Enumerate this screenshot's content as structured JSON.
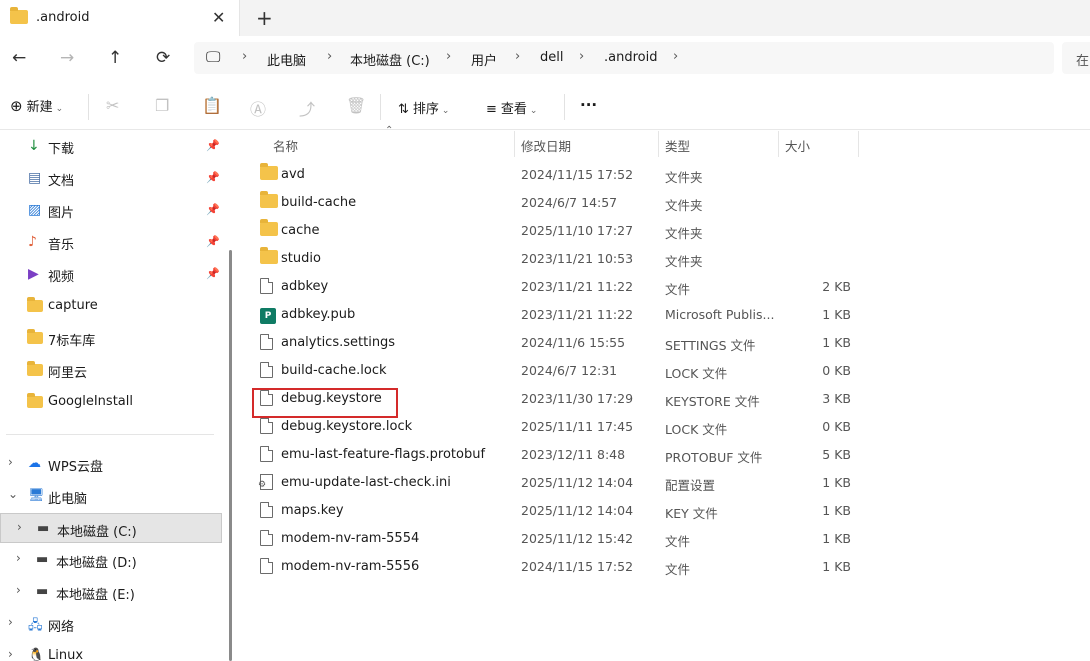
{
  "tab": {
    "title": ".android",
    "close": "✕",
    "new": "+"
  },
  "nav": {
    "back": "←",
    "forward": "→",
    "up": "↑",
    "refresh": "⟳",
    "computer": "🖵"
  },
  "breadcrumb": [
    "此电脑",
    "本地磁盘 (C:)",
    "用户",
    "dell",
    ".android"
  ],
  "search": {
    "hint": "在"
  },
  "toolbar": {
    "new_label": "新建",
    "sort_label": "排序",
    "view_label": "查看",
    "more_label": "···"
  },
  "sidebar": {
    "quick": [
      {
        "label": "下载",
        "icon": "↓",
        "color": "#1e8e3e",
        "pinned": true
      },
      {
        "label": "文档",
        "icon": "▤",
        "color": "#4a6fa5",
        "pinned": true
      },
      {
        "label": "图片",
        "icon": "▨",
        "color": "#2a7ad6",
        "pinned": true
      },
      {
        "label": "音乐",
        "icon": "♪",
        "color": "#e0603a",
        "pinned": true
      },
      {
        "label": "视频",
        "icon": "▶",
        "color": "#7b3fc4",
        "pinned": true
      },
      {
        "label": "capture",
        "icon": "folder",
        "pinned": false
      },
      {
        "label": "7标车库",
        "icon": "folder",
        "pinned": false
      },
      {
        "label": "阿里云",
        "icon": "folder",
        "pinned": false
      },
      {
        "label": "GoogleInstall",
        "icon": "folder",
        "pinned": false
      }
    ],
    "tree": [
      {
        "label": "WPS云盘",
        "chev": "›"
      },
      {
        "label": "此电脑",
        "chev": "⌄"
      },
      {
        "label": "本地磁盘 (C:)",
        "chev": "›",
        "selected": true
      },
      {
        "label": "本地磁盘 (D:)",
        "chev": "›"
      },
      {
        "label": "本地磁盘 (E:)",
        "chev": "›"
      },
      {
        "label": "网络",
        "chev": "›"
      },
      {
        "label": "Linux",
        "chev": "›"
      }
    ],
    "pin_glyph": "📌"
  },
  "columns": {
    "name": "名称",
    "date": "修改日期",
    "type": "类型",
    "size": "大小"
  },
  "files": [
    {
      "name": "avd",
      "date": "2024/11/15 17:52",
      "type": "文件夹",
      "size": "",
      "kind": "folder"
    },
    {
      "name": "build-cache",
      "date": "2024/6/7 14:57",
      "type": "文件夹",
      "size": "",
      "kind": "folder"
    },
    {
      "name": "cache",
      "date": "2025/11/10 17:27",
      "type": "文件夹",
      "size": "",
      "kind": "folder"
    },
    {
      "name": "studio",
      "date": "2023/11/21 10:53",
      "type": "文件夹",
      "size": "",
      "kind": "folder"
    },
    {
      "name": "adbkey",
      "date": "2023/11/21 11:22",
      "type": "文件",
      "size": "2 KB",
      "kind": "doc"
    },
    {
      "name": "adbkey.pub",
      "date": "2023/11/21 11:22",
      "type": "Microsoft Publis...",
      "size": "1 KB",
      "kind": "pub"
    },
    {
      "name": "analytics.settings",
      "date": "2024/11/6 15:55",
      "type": "SETTINGS 文件",
      "size": "1 KB",
      "kind": "doc"
    },
    {
      "name": "build-cache.lock",
      "date": "2024/6/7 12:31",
      "type": "LOCK 文件",
      "size": "0 KB",
      "kind": "doc"
    },
    {
      "name": "debug.keystore",
      "date": "2023/11/30 17:29",
      "type": "KEYSTORE 文件",
      "size": "3 KB",
      "kind": "doc"
    },
    {
      "name": "debug.keystore.lock",
      "date": "2025/11/11 17:45",
      "type": "LOCK 文件",
      "size": "0 KB",
      "kind": "doc"
    },
    {
      "name": "emu-last-feature-flags.protobuf",
      "date": "2023/12/11 8:48",
      "type": "PROTOBUF 文件",
      "size": "5 KB",
      "kind": "doc"
    },
    {
      "name": "emu-update-last-check.ini",
      "date": "2025/11/12 14:04",
      "type": "配置设置",
      "size": "1 KB",
      "kind": "ini"
    },
    {
      "name": "maps.key",
      "date": "2025/11/12 14:04",
      "type": "KEY 文件",
      "size": "1 KB",
      "kind": "doc"
    },
    {
      "name": "modem-nv-ram-5554",
      "date": "2025/11/12 15:42",
      "type": "文件",
      "size": "1 KB",
      "kind": "doc"
    },
    {
      "name": "modem-nv-ram-5556",
      "date": "2024/11/15 17:52",
      "type": "文件",
      "size": "1 KB",
      "kind": "doc"
    }
  ]
}
